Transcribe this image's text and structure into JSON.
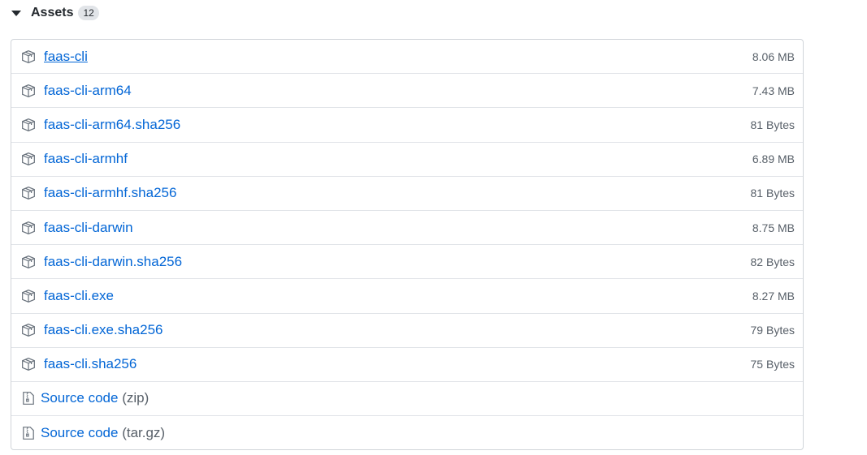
{
  "assets": {
    "title": "Assets",
    "count": "12",
    "files": [
      {
        "name": "faas-cli",
        "size": "8.06 MB"
      },
      {
        "name": "faas-cli-arm64",
        "size": "7.43 MB"
      },
      {
        "name": "faas-cli-arm64.sha256",
        "size": "81 Bytes"
      },
      {
        "name": "faas-cli-armhf",
        "size": "6.89 MB"
      },
      {
        "name": "faas-cli-armhf.sha256",
        "size": "81 Bytes"
      },
      {
        "name": "faas-cli-darwin",
        "size": "8.75 MB"
      },
      {
        "name": "faas-cli-darwin.sha256",
        "size": "82 Bytes"
      },
      {
        "name": "faas-cli.exe",
        "size": "8.27 MB"
      },
      {
        "name": "faas-cli.exe.sha256",
        "size": "79 Bytes"
      },
      {
        "name": "faas-cli.sha256",
        "size": "75 Bytes"
      }
    ],
    "source": [
      {
        "label": "Source code",
        "suffix": "(zip)"
      },
      {
        "label": "Source code",
        "suffix": "(tar.gz)"
      }
    ]
  },
  "icons": {
    "package": "package-icon",
    "zip": "file-zip-icon",
    "caret": "triangle-down-icon"
  },
  "colors": {
    "link": "#0366d6",
    "muted": "#586069",
    "border": "#d1d5da",
    "counter_bg": "#e1e4e8"
  }
}
